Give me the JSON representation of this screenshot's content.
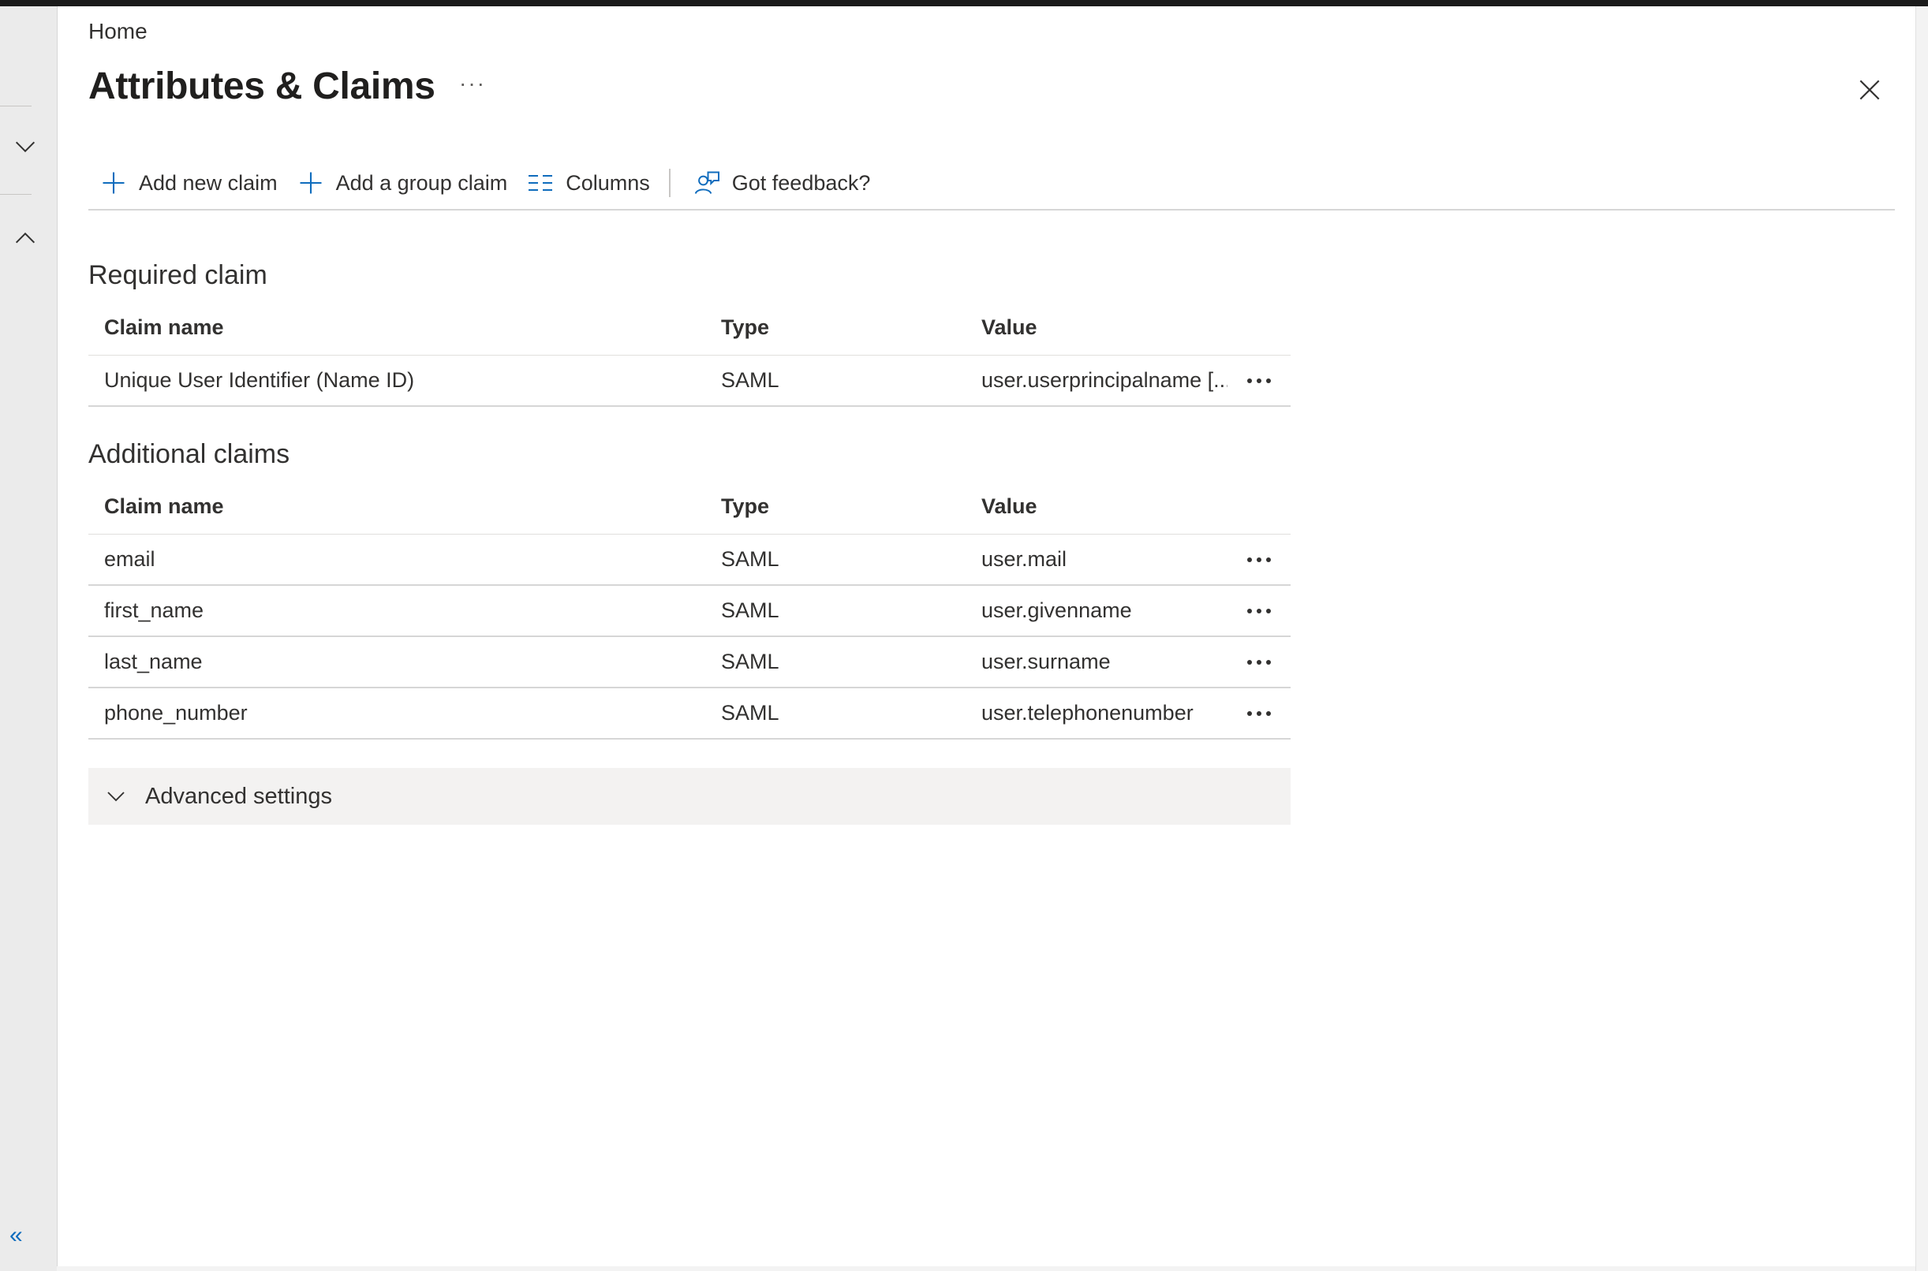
{
  "breadcrumb": {
    "home": "Home"
  },
  "page": {
    "title": "Attributes & Claims",
    "more": "···"
  },
  "toolbar": {
    "add_new_claim": "Add new claim",
    "add_group_claim": "Add a group claim",
    "columns": "Columns",
    "feedback": "Got feedback?"
  },
  "required": {
    "title": "Required claim",
    "headers": {
      "name": "Claim name",
      "type": "Type",
      "value": "Value"
    },
    "rows": [
      {
        "name": "Unique User Identifier (Name ID)",
        "type": "SAML",
        "value": "user.userprincipalname [..."
      }
    ]
  },
  "additional": {
    "title": "Additional claims",
    "headers": {
      "name": "Claim name",
      "type": "Type",
      "value": "Value"
    },
    "rows": [
      {
        "name": "email",
        "type": "SAML",
        "value": "user.mail"
      },
      {
        "name": "first_name",
        "type": "SAML",
        "value": "user.givenname"
      },
      {
        "name": "last_name",
        "type": "SAML",
        "value": "user.surname"
      },
      {
        "name": "phone_number",
        "type": "SAML",
        "value": "user.telephonenumber"
      }
    ]
  },
  "advanced": {
    "label": "Advanced settings"
  },
  "rail": {
    "collapse": "«"
  },
  "icons": {
    "close": "close-icon",
    "add": "plus-icon",
    "columns": "columns-icon",
    "feedback": "feedback-icon",
    "chevron_down": "chevron-down-icon",
    "chevron_up": "chevron-up-icon",
    "more": "more-icon"
  },
  "colors": {
    "accent": "#0f6cbd",
    "text": "#323130",
    "panel": "#f3f2f1"
  }
}
